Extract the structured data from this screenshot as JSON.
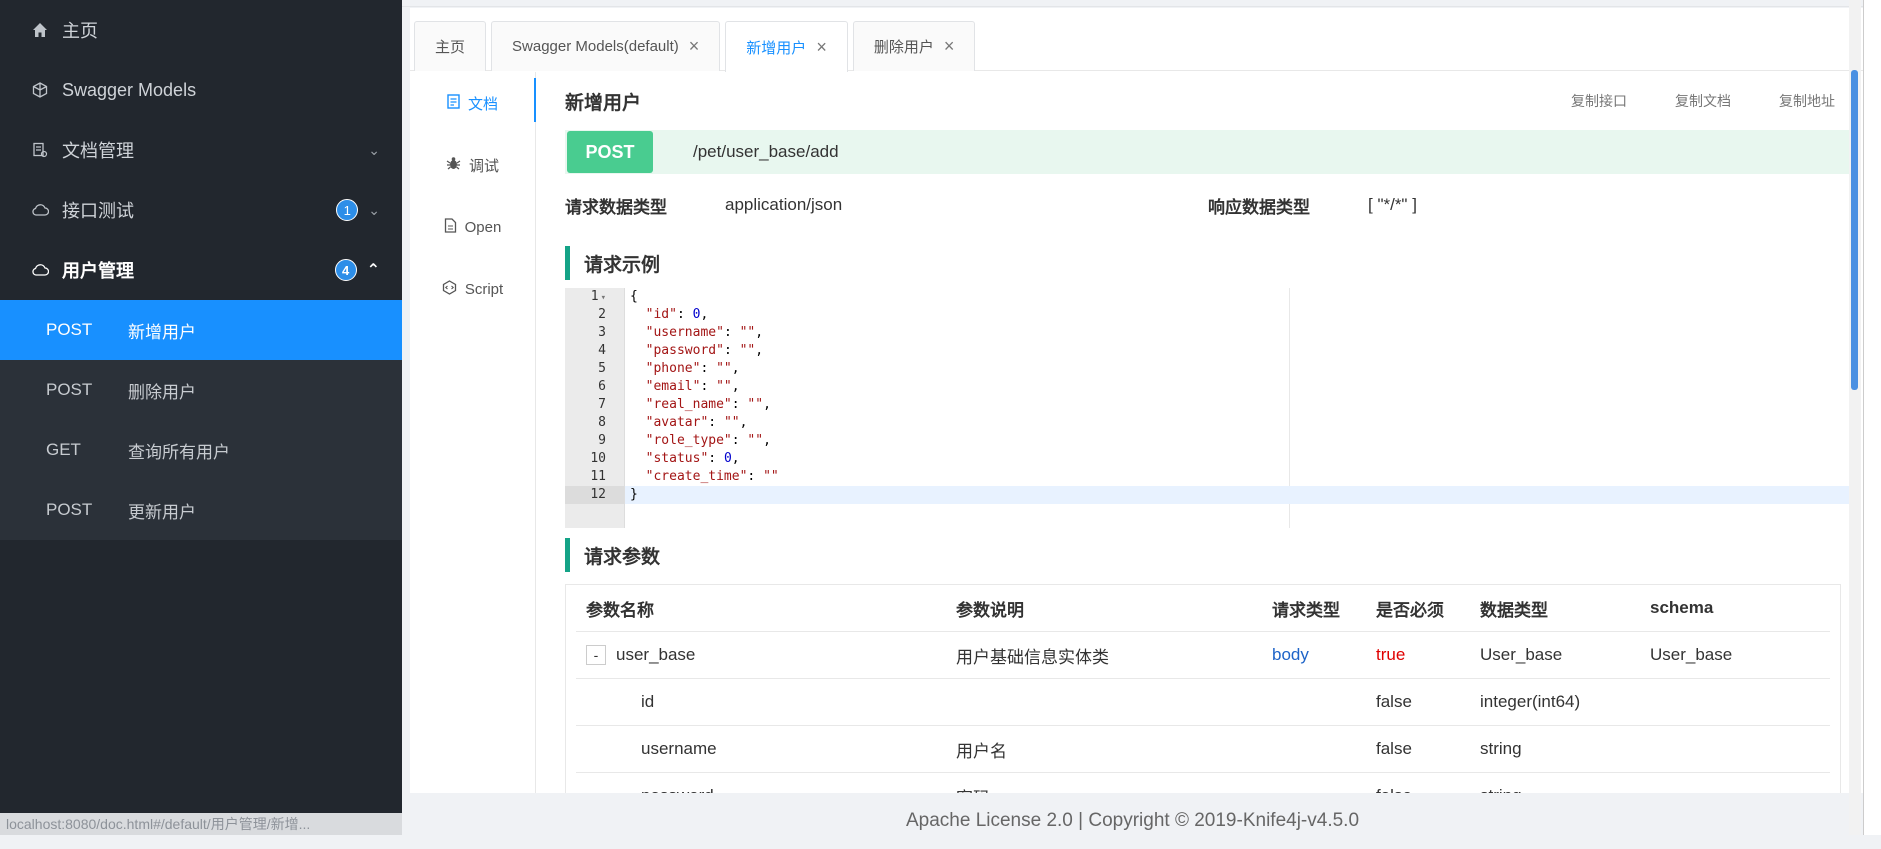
{
  "sidebar": {
    "items": [
      {
        "label": "主页",
        "icon": "home-icon"
      },
      {
        "label": "Swagger Models",
        "icon": "cube-icon"
      },
      {
        "label": "文档管理",
        "icon": "document-manage-icon"
      },
      {
        "label": "接口测试",
        "icon": "cloud-icon",
        "badge": "1"
      },
      {
        "label": "用户管理",
        "icon": "cloud-icon",
        "badge": "4"
      }
    ],
    "submenu": [
      {
        "method": "POST",
        "label": "新增用户",
        "active": true
      },
      {
        "method": "POST",
        "label": "删除用户"
      },
      {
        "method": "GET",
        "label": "查询所有用户"
      },
      {
        "method": "POST",
        "label": "更新用户"
      }
    ],
    "status_url": "localhost:8080/doc.html#/default/用户管理/新增..."
  },
  "tabs": [
    {
      "label": "主页"
    },
    {
      "label": "Swagger Models(default)",
      "closable": true
    },
    {
      "label": "新增用户",
      "closable": true,
      "active": true
    },
    {
      "label": "删除用户",
      "closable": true
    }
  ],
  "vtabs": [
    {
      "label": "文档",
      "icon": "doc-icon"
    },
    {
      "label": "调试",
      "icon": "bug-icon"
    },
    {
      "label": "Open",
      "icon": "file-icon"
    },
    {
      "label": "Script",
      "icon": "code-icon"
    }
  ],
  "doc": {
    "title": "新增用户",
    "actions": [
      "复制接口",
      "复制文档",
      "复制地址"
    ],
    "method": "POST",
    "path": "/pet/user_base/add",
    "req_type_label": "请求数据类型",
    "req_type_value": "application/json",
    "resp_type_label": "响应数据类型",
    "resp_type_value": "[ \"*/*\" ]",
    "example_title": "请求示例",
    "params_title": "请求参数"
  },
  "code_lines": [
    "{",
    "  \"id\": 0,",
    "  \"username\": \"\",",
    "  \"password\": \"\",",
    "  \"phone\": \"\",",
    "  \"email\": \"\",",
    "  \"real_name\": \"\",",
    "  \"avatar\": \"\",",
    "  \"role_type\": \"\",",
    "  \"status\": 0,",
    "  \"create_time\": \"\"",
    "}"
  ],
  "params": {
    "headers": [
      "参数名称",
      "参数说明",
      "请求类型",
      "是否必须",
      "数据类型",
      "schema"
    ],
    "rows": [
      {
        "name": "user_base",
        "desc": "用户基础信息实体类",
        "in": "body",
        "required": "true",
        "type": "User_base",
        "schema": "User_base",
        "expandable": true
      },
      {
        "name": "id",
        "desc": "",
        "in": "",
        "required": "false",
        "type": "integer(int64)",
        "schema": ""
      },
      {
        "name": "username",
        "desc": "用户名",
        "in": "",
        "required": "false",
        "type": "string",
        "schema": ""
      },
      {
        "name": "password",
        "desc": "密码",
        "in": "",
        "required": "false",
        "type": "string",
        "schema": ""
      }
    ]
  },
  "footer": "Apache License 2.0 | Copyright © 2019-Knife4j-v4.5.0",
  "colors": {
    "accent": "#1890ff",
    "post": "#49cc90",
    "sidebar": "#22272e"
  }
}
